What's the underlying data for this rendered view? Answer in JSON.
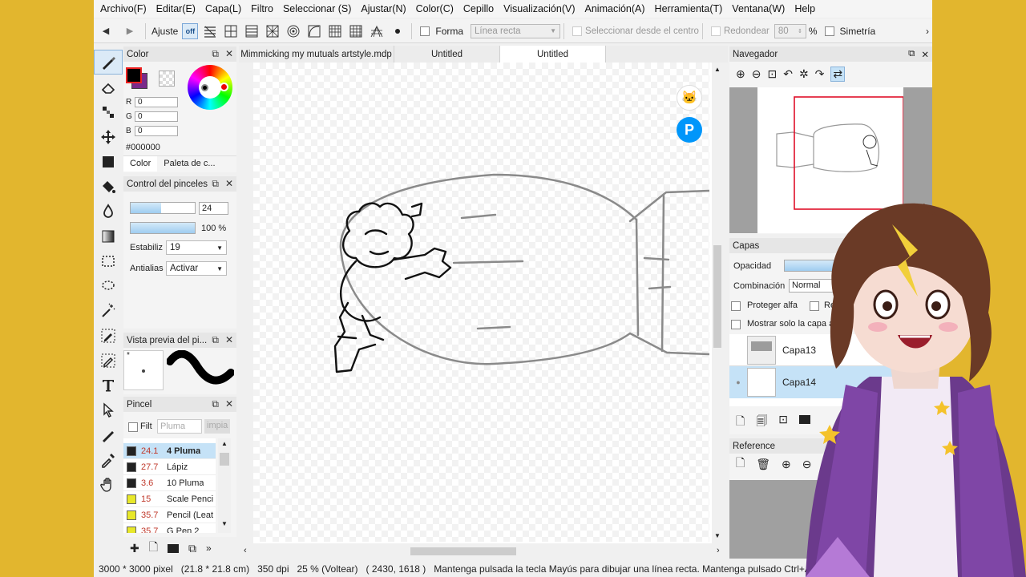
{
  "menu": [
    "Archivo(F)",
    "Editar(E)",
    "Capa(L)",
    "Filtro",
    "Seleccionar (S)",
    "Ajustar(N)",
    "Color(C)",
    "Cepillo",
    "Visualización(V)",
    "Animación(A)",
    "Herramienta(T)",
    "Ventana(W)",
    "Help"
  ],
  "toolbar": {
    "ajuste_label": "Ajuste",
    "snap_state": "off",
    "forma_label": "Forma",
    "forma_select": "Línea recta",
    "select_from_center": "Seleccionar desde el centro",
    "rounded_label": "Redondear",
    "rounded_value": "80",
    "percent": "%",
    "symmetry_label": "Simetría"
  },
  "color_panel": {
    "title": "Color",
    "r_label": "R",
    "r_value": "0",
    "g_label": "G",
    "g_value": "0",
    "b_label": "B",
    "b_value": "0",
    "hex": "#000000",
    "tab_color": "Color",
    "tab_palette": "Paleta de c..."
  },
  "brush_control": {
    "title": "Control del pinceles",
    "size_value": "24",
    "opacity_value": "100 %",
    "stabilizer_label": "Estabiliz",
    "stabilizer_value": "19",
    "antialias_label": "Antialias",
    "antialias_value": "Activar"
  },
  "brush_preview": {
    "title": "Vista previa del pi...",
    "asterisk": "*"
  },
  "brush_list": {
    "title": "Pincel",
    "filter_label": "Filt",
    "filter_placeholder": "Pluma",
    "clear_label": "impia",
    "items": [
      {
        "size": "24.1",
        "name": "4 Pluma",
        "swatch": "#222222",
        "selected": true
      },
      {
        "size": "27.7",
        "name": "Lápiz",
        "swatch": "#222222",
        "selected": false
      },
      {
        "size": "3.6",
        "name": "10 Pluma",
        "swatch": "#222222",
        "selected": false
      },
      {
        "size": "15",
        "name": "Scale Penci",
        "swatch": "#e8e82a",
        "selected": false
      },
      {
        "size": "35.7",
        "name": "Pencil (Leat",
        "swatch": "#e8e82a",
        "selected": false
      },
      {
        "size": "35.7",
        "name": "G Pen 2",
        "swatch": "#e8e82a",
        "selected": false
      }
    ]
  },
  "tabs": [
    {
      "label": "Mimmicking my mutuals artstyle.mdp",
      "active": false
    },
    {
      "label": "Untitled",
      "active": false
    },
    {
      "label": "Untitled",
      "active": true
    }
  ],
  "navigator": {
    "title": "Navegador"
  },
  "layers": {
    "title": "Capas",
    "opacity_label": "Opacidad",
    "blend_label": "Combinación",
    "blend_value": "Normal",
    "protect_alpha": "Proteger alfa",
    "clip_partial": "Re",
    "show_only_active": "Mostrar solo la capa activ",
    "items": [
      {
        "name": "Capa13",
        "selected": false
      },
      {
        "name": "Capa14",
        "selected": true
      }
    ]
  },
  "reference": {
    "title": "Reference"
  },
  "status": {
    "size": "3000 * 3000 pixel",
    "cm": "(21.8 * 21.8 cm)",
    "dpi": "350 dpi",
    "zoom": "25 % (Voltear)",
    "coords": "( 2430, 1618 )",
    "hint": "Mantenga pulsada la tecla Mayús para dibujar una línea recta. Mantenga pulsado Ctrl+A"
  },
  "colors": {
    "accent": "#e2b62e",
    "selection": "#c5e2f7",
    "fg_color": "#000000",
    "bg_color": "#7a2a8a"
  }
}
